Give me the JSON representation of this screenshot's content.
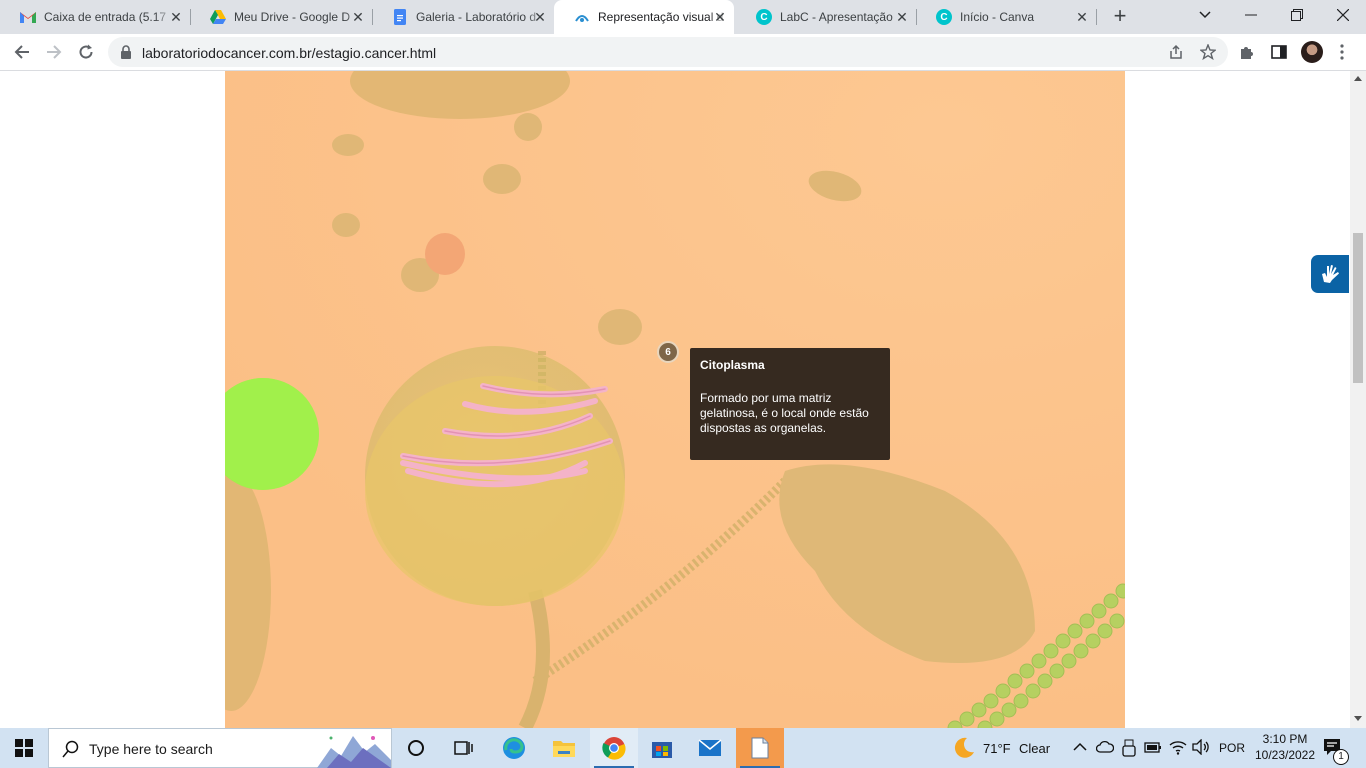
{
  "browser": {
    "tabs": [
      {
        "title": "Caixa de entrada (5.17",
        "icon": "gmail-icon",
        "active": false
      },
      {
        "title": "Meu Drive - Google D",
        "icon": "google-drive-icon",
        "active": false
      },
      {
        "title": "Galeria - Laboratório d",
        "icon": "google-docs-icon",
        "active": false
      },
      {
        "title": "Representação visual d",
        "icon": "site-icon",
        "active": true
      },
      {
        "title": "LabC - Apresentação",
        "icon": "canva-icon",
        "active": false
      },
      {
        "title": "Início - Canva",
        "icon": "canva-icon",
        "active": false
      }
    ],
    "url": "laboratoriodocancer.com.br/estagio.cancer.html"
  },
  "page": {
    "hotspot_number": "6",
    "tooltip": {
      "title": "Citoplasma",
      "body": "Formado por uma matriz gelatinosa, é o local onde estão dispostas as organelas."
    },
    "colors": {
      "cytoplasm": "#fcc38b",
      "tooltip_bg": "#362a20",
      "accessibility_button": "#0b63a5"
    }
  },
  "taskbar": {
    "search_placeholder": "Type here to search",
    "weather": {
      "temp": "71°F",
      "condition": "Clear"
    },
    "language": "POR",
    "time": "3:10 PM",
    "date": "10/23/2022",
    "notification_count": "1"
  }
}
